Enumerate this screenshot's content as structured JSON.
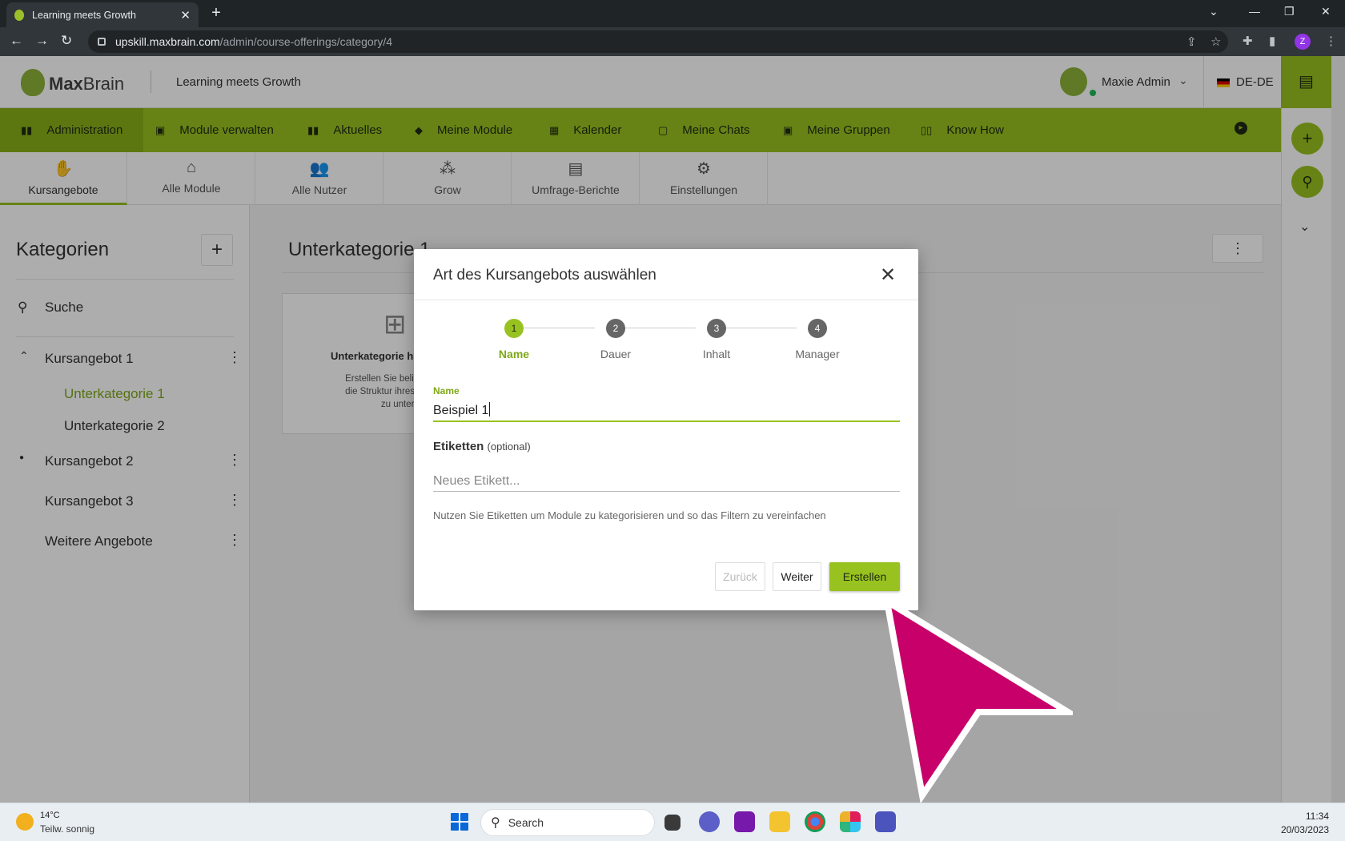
{
  "browser": {
    "tab_title": "Learning meets Growth",
    "url_host": "upskill.maxbrain.com",
    "url_path": "/admin/course-offerings/category/4",
    "profile_initial": "Z"
  },
  "header": {
    "logo_bold": "Max",
    "logo_light": "Brain",
    "tagline": "Learning meets Growth",
    "user_name": "Maxie Admin",
    "language": "DE-DE"
  },
  "nav": {
    "items": [
      {
        "label": "Administration"
      },
      {
        "label": "Module verwalten"
      },
      {
        "label": "Aktuelles"
      },
      {
        "label": "Meine Module"
      },
      {
        "label": "Kalender"
      },
      {
        "label": "Meine Chats"
      },
      {
        "label": "Meine Gruppen"
      },
      {
        "label": "Know How"
      }
    ]
  },
  "subtabs": [
    {
      "label": "Kursangebote"
    },
    {
      "label": "Alle Module"
    },
    {
      "label": "Alle Nutzer"
    },
    {
      "label": "Grow"
    },
    {
      "label": "Umfrage-Berichte"
    },
    {
      "label": "Einstellungen"
    }
  ],
  "sidebar": {
    "title": "Kategorien",
    "search_label": "Suche",
    "categories": [
      {
        "label": "Kursangebot 1"
      },
      {
        "label": "Kursangebot 2"
      },
      {
        "label": "Kursangebot 3"
      },
      {
        "label": "Weitere Angebote"
      }
    ],
    "subcategories": [
      {
        "label": "Unterkategorie 1"
      },
      {
        "label": "Unterkategorie 2"
      }
    ]
  },
  "main": {
    "title": "Unterkategorie 1",
    "card_title": "Unterkategorie hi",
    "card_desc_1": "Erstellen Sie beliebig viele U",
    "card_desc_2": "die Struktur ihres Kursangeb",
    "card_desc_3": "zu unterteil"
  },
  "modal": {
    "title": "Art des Kursangebots auswählen",
    "steps": [
      {
        "num": "1",
        "label": "Name"
      },
      {
        "num": "2",
        "label": "Dauer"
      },
      {
        "num": "3",
        "label": "Inhalt"
      },
      {
        "num": "4",
        "label": "Manager"
      }
    ],
    "name_label": "Name",
    "name_value": "Beispiel 1",
    "tags_label": "Etiketten",
    "tags_optional": "(optional)",
    "tags_placeholder": "Neues Etikett...",
    "hint": "Nutzen Sie Etiketten um Module zu kategorisieren und so das Filtern zu vereinfachen",
    "back_label": "Zurück",
    "next_label": "Weiter",
    "create_label": "Erstellen"
  },
  "taskbar": {
    "temperature": "14°C",
    "weather": "Teilw. sonnig",
    "search_label": "Search",
    "time": "11:34",
    "date": "20/03/2023"
  },
  "colors": {
    "accent_green": "#98c21f",
    "cursor_magenta": "#c8006a"
  }
}
